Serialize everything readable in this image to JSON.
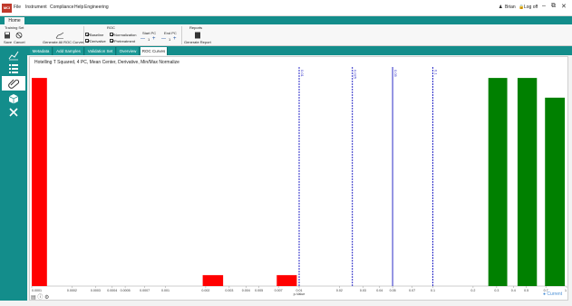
{
  "menu": {
    "logo": "MCI",
    "items": [
      "File",
      "Instrument",
      "Compliance",
      "Help",
      "Engineering"
    ],
    "user": "Brian",
    "logoff": "Log off"
  },
  "ribbon": {
    "home_tab": "Home",
    "training_set": {
      "group_label": "Training Set",
      "save": "Save",
      "cancel": "Cancel",
      "generate_all": "Generate All ROC Curves"
    },
    "roc": {
      "group_label": "ROC",
      "baseline": "Baseline",
      "derivative": "Derivative",
      "normalization": "Normalization",
      "pretreatment": "Pretreatment",
      "start_pc_label": "Start PC",
      "end_pc_label": "End PC",
      "start_pc": "1",
      "end_pc": "1"
    },
    "reports": {
      "group_label": "Reports",
      "generate": "Generate Report"
    }
  },
  "subtabs": [
    {
      "label": "Metadata",
      "active": false
    },
    {
      "label": "Add Samples",
      "active": false
    },
    {
      "label": "Validation Set",
      "active": false
    },
    {
      "label": "Overview",
      "active": false
    },
    {
      "label": "ROC Curves",
      "active": true
    }
  ],
  "sidebar_icons": [
    "line-chart-icon",
    "list-icon",
    "paperclip-icon",
    "cube-icon",
    "tools-icon"
  ],
  "chart_data": {
    "type": "bar",
    "title": "Hotelling T Squared, 4 PC, Mean Center, Derivative, Min/Max Normalize",
    "xlabel": "p-Value",
    "x_scale": "log",
    "xlim": [
      0.0001,
      1
    ],
    "ylim": [
      0,
      1
    ],
    "x_tick_labels": [
      "0.0001",
      "0.0002",
      "0.0003",
      "0.0004",
      "0.0005",
      "0.0007",
      "0.001",
      "0.002",
      "0.003",
      "0.004",
      "0.005",
      "0.007",
      "0.01",
      "0.02",
      "0.03",
      "0.04",
      "0.05",
      "0.07",
      "0.1",
      "0.2",
      "0.3",
      "0.4",
      "0.5",
      "0.7",
      "1"
    ],
    "x_ticks": [
      0.0001,
      0.0002,
      0.0003,
      0.0004,
      0.0005,
      0.0007,
      0.001,
      0.002,
      0.003,
      0.004,
      0.005,
      0.007,
      0.01,
      0.02,
      0.03,
      0.04,
      0.05,
      0.07,
      0.1,
      0.2,
      0.3,
      0.4,
      0.5,
      0.7,
      1
    ],
    "series": [
      {
        "color": "#ff0000",
        "bars": [
          {
            "x_from": 0.0001,
            "x_to": 0.00013,
            "y": 0.95
          },
          {
            "x_from": 0.0019,
            "x_to": 0.0027,
            "y": 0.05
          },
          {
            "x_from": 0.0068,
            "x_to": 0.0096,
            "y": 0.05
          }
        ]
      },
      {
        "color": "#008000",
        "bars": [
          {
            "x_from": 0.26,
            "x_to": 0.36,
            "y": 0.95
          },
          {
            "x_from": 0.43,
            "x_to": 0.6,
            "y": 0.95
          },
          {
            "x_from": 0.69,
            "x_to": 0.97,
            "y": 0.86
          }
        ]
      }
    ],
    "vlines": [
      {
        "x": 0.01,
        "label": "0.01",
        "style": "dashed"
      },
      {
        "x": 0.025,
        "label": "0.025",
        "style": "dashed"
      },
      {
        "x": 0.05,
        "label": "0.05",
        "style": "solid"
      },
      {
        "x": 0.1,
        "label": "0.1",
        "style": "dashed"
      }
    ],
    "legend": {
      "label": "Current",
      "color": "#4a8fd6",
      "position": "bottom-right"
    }
  }
}
